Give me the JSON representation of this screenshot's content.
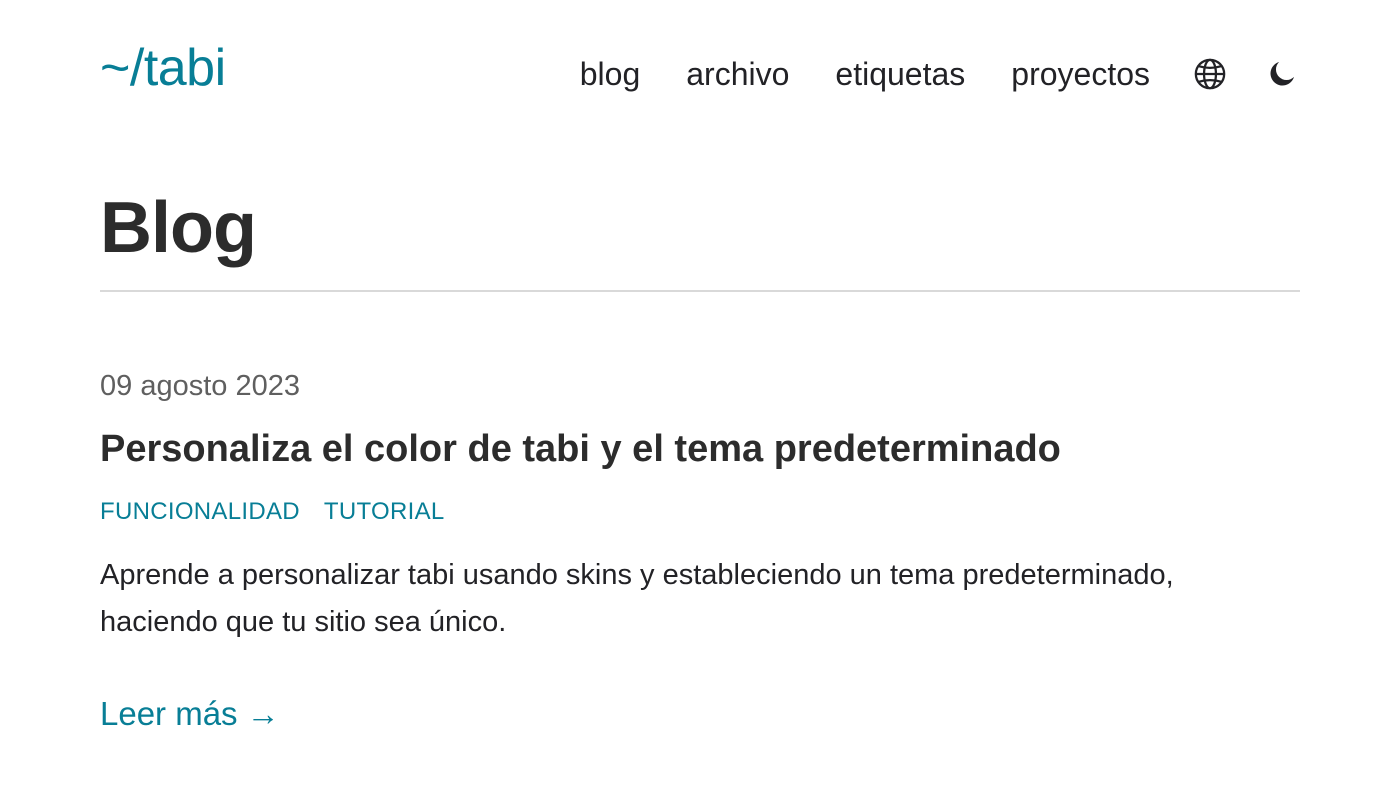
{
  "header": {
    "logo": "~/tabi",
    "nav": [
      {
        "label": "blog"
      },
      {
        "label": "archivo"
      },
      {
        "label": "etiquetas"
      },
      {
        "label": "proyectos"
      }
    ],
    "icons": {
      "language": "globe-icon",
      "theme": "moon-icon"
    }
  },
  "main": {
    "title": "Blog",
    "posts": [
      {
        "date": "09 agosto 2023",
        "title": "Personaliza el color de tabi y el tema predeterminado",
        "tags": [
          "FUNCIONALIDAD",
          "TUTORIAL"
        ],
        "summary": "Aprende a personalizar tabi usando skins y estableciendo un tema predeterminado, haciendo que tu sitio sea único.",
        "read_more": "Leer más →"
      }
    ]
  },
  "colors": {
    "accent": "#087e96",
    "text": "#222226",
    "muted": "#5f5f5f",
    "divider": "#d9d9d9"
  }
}
